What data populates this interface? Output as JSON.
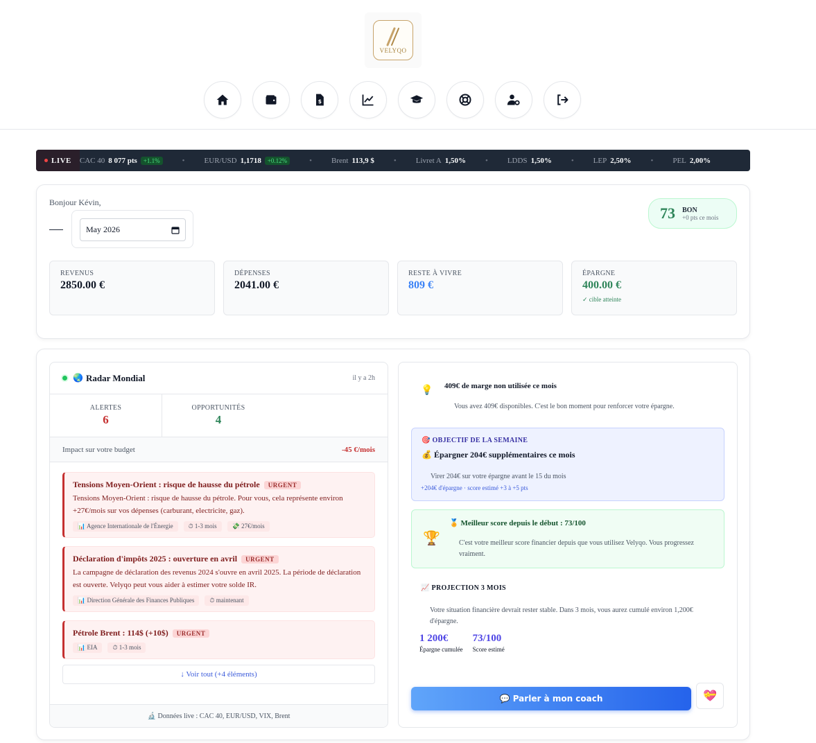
{
  "brand": {
    "name": "VELYQO"
  },
  "nav": [
    {
      "id": "home",
      "icon": "home-icon"
    },
    {
      "id": "wallet",
      "icon": "wallet-icon"
    },
    {
      "id": "invoice",
      "icon": "invoice-icon"
    },
    {
      "id": "chart",
      "icon": "chart-line-icon"
    },
    {
      "id": "learn",
      "icon": "graduation-cap-icon"
    },
    {
      "id": "help",
      "icon": "lifebuoy-icon"
    },
    {
      "id": "account",
      "icon": "user-settings-icon"
    },
    {
      "id": "logout",
      "icon": "logout-icon"
    }
  ],
  "ticker": {
    "live_label": "LIVE",
    "items": [
      {
        "name": "CAC 40",
        "value": "8 077 pts",
        "change": "+1.1%"
      },
      {
        "name": "EUR/USD",
        "value": "1,1718",
        "change": "+0.12%"
      },
      {
        "name": "Brent",
        "value": "113,9 $",
        "change": ""
      },
      {
        "name": "Livret A",
        "value": "1,50%",
        "change": ""
      },
      {
        "name": "LDDS",
        "value": "1,50%",
        "change": ""
      },
      {
        "name": "LEP",
        "value": "2,50%",
        "change": ""
      },
      {
        "name": "PEL",
        "value": "2,00%",
        "change": ""
      }
    ],
    "separator": "•"
  },
  "summary": {
    "greeting": "Bonjour Kévin,",
    "month_value": "May 2026",
    "score": {
      "value": "73",
      "label": "BON",
      "delta": "+0 pts ce mois"
    },
    "stats": [
      {
        "label": "REVENUS",
        "value": "2850.00 €",
        "note": ""
      },
      {
        "label": "DÉPENSES",
        "value": "2041.00 €",
        "note": ""
      },
      {
        "label": "RESTE À VIVRE",
        "value": "809 €",
        "note": ""
      },
      {
        "label": "ÉPARGNE",
        "value": "400.00 €",
        "note": "✓ cible atteinte"
      }
    ]
  },
  "radar": {
    "globe": "🌏",
    "title": "Radar Mondial",
    "time": "il y a 2h",
    "alerts_label": "ALERTES",
    "alerts_count": "6",
    "opps_label": "OPPORTUNITÉS",
    "opps_count": "4",
    "impact_label": "Impact sur votre budget",
    "impact_value": "-45 €/mois",
    "items": [
      {
        "title": "Tensions Moyen-Orient : risque de hausse du pétrole",
        "badge": "URGENT",
        "body": "Tensions Moyen-Orient : risque de hausse du pétrole. Pour vous, cela représente environ +27€/mois sur vos dépenses (carburant, electricite, gaz).",
        "tags": [
          "📊 Agence Internationale de l'Énergie",
          "⏱ 1-3 mois",
          "💸 27€/mois"
        ]
      },
      {
        "title": "Déclaration d'impôts 2025 : ouverture en avril",
        "badge": "URGENT",
        "body": "La campagne de déclaration des revenus 2024 s'ouvre en avril 2025. La période de déclaration est ouverte. Velyqo peut vous aider à estimer votre solde IR.",
        "tags": [
          "📊 Direction Générale des Finances Publiques",
          "⏱ maintenant"
        ]
      },
      {
        "title": "Pétrole Brent : 114$ (+10$)",
        "badge": "URGENT",
        "body": "",
        "tags": [
          "📊 EIA",
          "⏱ 1-3 mois"
        ]
      }
    ],
    "see_all": "↓ Voir tout (+4 éléments)",
    "footer": "🔬 Données live : CAC 40, EUR/USD, VIX, Brent"
  },
  "coach": {
    "tip": {
      "icon": "💡",
      "title": "409€ de marge non utilisée ce mois",
      "body": "Vous avez 409€ disponibles. C'est le bon moment pour renforcer votre épargne."
    },
    "goal": {
      "kicker": "🎯 OBJECTIF DE LA SEMAINE",
      "title": "💰 Épargner 204€ supplémentaires ce mois",
      "body": "Virer 204€ sur votre épargne avant le 15 du mois",
      "meta": "+204€ d'épargne · score estimé +3 à +5 pts"
    },
    "best": {
      "icon": "🏆",
      "title": "🏅 Meilleur score depuis le début : 73/100",
      "body": "C'est votre meilleur score financier depuis que vous utilisez Velyqo. Vous progressez vraiment."
    },
    "projection": {
      "kicker": "📈 PROJECTION 3 MOIS",
      "body": "Votre situation financière devrait rester stable. Dans 3 mois, vous aurez cumulé environ 1,200€ d'épargne.",
      "stats": [
        {
          "value": "1 200€",
          "label": "Épargne cumulée"
        },
        {
          "value": "73/100",
          "label": "Score estimé"
        }
      ]
    },
    "cta_label": "💬 Parler à mon coach",
    "heart_icon": "💝"
  },
  "colors": {
    "accent_blue": "#2563eb",
    "success_green": "#2f855a",
    "danger_red": "#c53030",
    "ticker_bg": "#1f2937"
  }
}
